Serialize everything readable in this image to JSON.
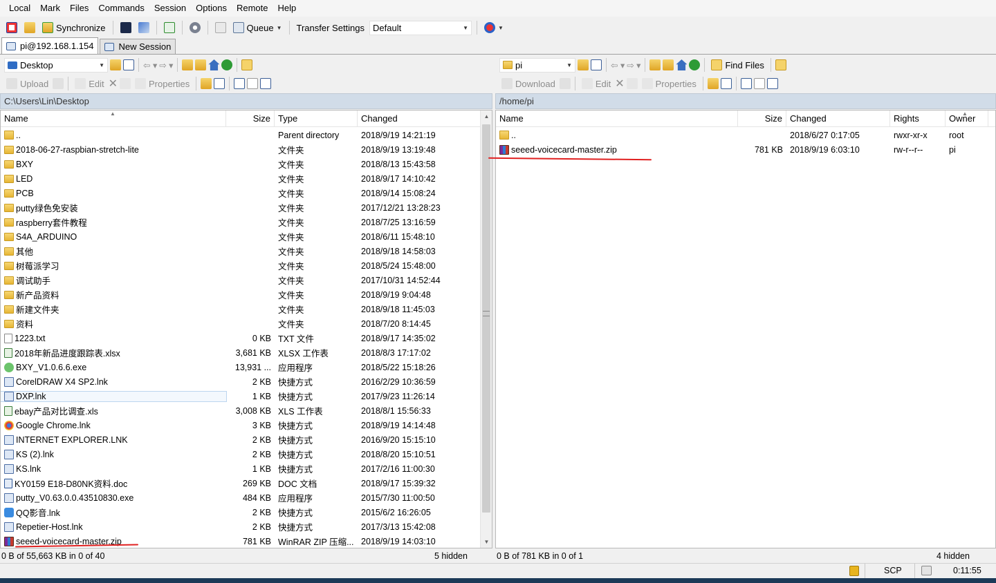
{
  "menu": [
    "Local",
    "Mark",
    "Files",
    "Commands",
    "Session",
    "Options",
    "Remote",
    "Help"
  ],
  "toolbar": {
    "synchronize": "Synchronize",
    "queue": "Queue",
    "transfer_settings": "Transfer Settings",
    "transfer_preset": "Default"
  },
  "tabs": [
    {
      "label": "pi@192.168.1.154",
      "active": true
    },
    {
      "label": "New Session",
      "active": false
    }
  ],
  "left": {
    "location": "Desktop",
    "actions": {
      "upload": "Upload",
      "edit": "Edit",
      "properties": "Properties"
    },
    "path": "C:\\Users\\Lin\\Desktop",
    "columns": [
      "Name",
      "Size",
      "Type",
      "Changed"
    ],
    "rows": [
      {
        "icon": "parent",
        "name": "..",
        "size": "",
        "type": "Parent directory",
        "changed": "2018/9/19  14:21:19"
      },
      {
        "icon": "folder",
        "name": "2018-06-27-raspbian-stretch-lite",
        "size": "",
        "type": "文件夹",
        "changed": "2018/9/19  13:19:48"
      },
      {
        "icon": "folder",
        "name": "BXY",
        "size": "",
        "type": "文件夹",
        "changed": "2018/8/13  15:43:58"
      },
      {
        "icon": "folder",
        "name": "LED",
        "size": "",
        "type": "文件夹",
        "changed": "2018/9/17  14:10:42"
      },
      {
        "icon": "folder",
        "name": "PCB",
        "size": "",
        "type": "文件夹",
        "changed": "2018/9/14  15:08:24"
      },
      {
        "icon": "folder",
        "name": "putty绿色免安装",
        "size": "",
        "type": "文件夹",
        "changed": "2017/12/21  13:28:23"
      },
      {
        "icon": "folder",
        "name": "raspberry套件教程",
        "size": "",
        "type": "文件夹",
        "changed": "2018/7/25  13:16:59"
      },
      {
        "icon": "folder",
        "name": "S4A_ARDUINO",
        "size": "",
        "type": "文件夹",
        "changed": "2018/6/11  15:48:10"
      },
      {
        "icon": "folder",
        "name": "其他",
        "size": "",
        "type": "文件夹",
        "changed": "2018/9/18  14:58:03"
      },
      {
        "icon": "folder",
        "name": "树莓派学习",
        "size": "",
        "type": "文件夹",
        "changed": "2018/5/24  15:48:00"
      },
      {
        "icon": "folder",
        "name": "调试助手",
        "size": "",
        "type": "文件夹",
        "changed": "2017/10/31  14:52:44"
      },
      {
        "icon": "folder",
        "name": "新产品资料",
        "size": "",
        "type": "文件夹",
        "changed": "2018/9/19  9:04:48"
      },
      {
        "icon": "folder",
        "name": "新建文件夹",
        "size": "",
        "type": "文件夹",
        "changed": "2018/9/18  11:45:03"
      },
      {
        "icon": "folder",
        "name": "资料",
        "size": "",
        "type": "文件夹",
        "changed": "2018/7/20  8:14:45"
      },
      {
        "icon": "file",
        "name": "1223.txt",
        "size": "0 KB",
        "type": "TXT 文件",
        "changed": "2018/9/17  14:35:02"
      },
      {
        "icon": "xls",
        "name": "2018年新品进度跟踪表.xlsx",
        "size": "3,681 KB",
        "type": "XLSX 工作表",
        "changed": "2018/8/3  17:17:02"
      },
      {
        "icon": "exe",
        "name": "BXY_V1.0.6.6.exe",
        "size": "13,931 ...",
        "type": "应用程序",
        "changed": "2018/5/22  15:18:26"
      },
      {
        "icon": "lnk",
        "name": "CorelDRAW X4 SP2.lnk",
        "size": "2 KB",
        "type": "快捷方式",
        "changed": "2016/2/29  10:36:59"
      },
      {
        "icon": "lnk",
        "name": "DXP.lnk",
        "size": "1 KB",
        "type": "快捷方式",
        "changed": "2017/9/23  11:26:14",
        "selected": true
      },
      {
        "icon": "xls",
        "name": "ebay产品对比调查.xls",
        "size": "3,008 KB",
        "type": "XLS 工作表",
        "changed": "2018/8/1  15:56:33"
      },
      {
        "icon": "chrome",
        "name": "Google Chrome.lnk",
        "size": "3 KB",
        "type": "快捷方式",
        "changed": "2018/9/19  14:14:48"
      },
      {
        "icon": "lnk",
        "name": "INTERNET EXPLORER.LNK",
        "size": "2 KB",
        "type": "快捷方式",
        "changed": "2016/9/20  15:15:10"
      },
      {
        "icon": "lnk",
        "name": "KS (2).lnk",
        "size": "2 KB",
        "type": "快捷方式",
        "changed": "2018/8/20  15:10:51"
      },
      {
        "icon": "lnk",
        "name": "KS.lnk",
        "size": "1 KB",
        "type": "快捷方式",
        "changed": "2017/2/16  11:00:30"
      },
      {
        "icon": "doc",
        "name": "KY0159 E18-D80NK资料.doc",
        "size": "269 KB",
        "type": "DOC 文档",
        "changed": "2018/9/17  15:39:32"
      },
      {
        "icon": "lnk",
        "name": "putty_V0.63.0.0.43510830.exe",
        "size": "484 KB",
        "type": "应用程序",
        "changed": "2015/7/30  11:00:50"
      },
      {
        "icon": "qq",
        "name": "QQ影音.lnk",
        "size": "2 KB",
        "type": "快捷方式",
        "changed": "2015/6/2  16:26:05"
      },
      {
        "icon": "lnk",
        "name": "Repetier-Host.lnk",
        "size": "2 KB",
        "type": "快捷方式",
        "changed": "2017/3/13  15:42:08"
      },
      {
        "icon": "zip",
        "name": "seeed-voicecard-master.zip",
        "size": "781 KB",
        "type": "WinRAR ZIP 压缩...",
        "changed": "2018/9/19  14:03:10"
      }
    ],
    "status": "0 B of 55,663 KB in 0 of 40",
    "hidden": "5 hidden"
  },
  "right": {
    "location": "pi",
    "find_files": "Find Files",
    "actions": {
      "download": "Download",
      "edit": "Edit",
      "properties": "Properties"
    },
    "path": "/home/pi",
    "columns": [
      "Name",
      "Size",
      "Changed",
      "Rights",
      "Owner"
    ],
    "rows": [
      {
        "icon": "parent",
        "name": "..",
        "size": "",
        "changed": "2018/6/27 0:17:05",
        "rights": "rwxr-xr-x",
        "owner": "root"
      },
      {
        "icon": "zip",
        "name": "seeed-voicecard-master.zip",
        "size": "781 KB",
        "changed": "2018/9/19 6:03:10",
        "rights": "rw-r--r--",
        "owner": "pi"
      }
    ],
    "status": "0 B of 781 KB in 0 of 1",
    "hidden": "4 hidden"
  },
  "bottom": {
    "protocol": "SCP",
    "time": "0:11:55"
  }
}
